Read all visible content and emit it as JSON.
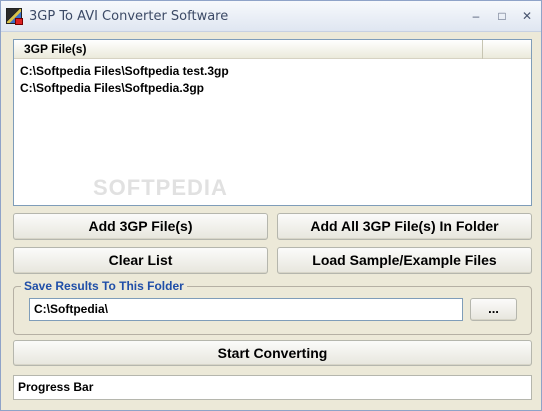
{
  "window": {
    "title": "3GP To AVI Converter Software",
    "controls": {
      "minimize": "–",
      "maximize": "□",
      "close": "✕"
    }
  },
  "file_list": {
    "column_header": "3GP File(s)",
    "items": [
      "C:\\Softpedia Files\\Softpedia test.3gp",
      "C:\\Softpedia Files\\Softpedia.3gp"
    ]
  },
  "buttons": {
    "add_files": "Add 3GP File(s)",
    "add_folder": "Add All 3GP File(s) In Folder",
    "clear_list": "Clear List",
    "load_samples": "Load Sample/Example Files",
    "browse": "...",
    "start": "Start Converting"
  },
  "save_group": {
    "label": "Save Results To This Folder",
    "folder_value": "C:\\Softpedia\\"
  },
  "progress": {
    "text": "Progress Bar"
  },
  "watermark": "SOFTPEDIA"
}
